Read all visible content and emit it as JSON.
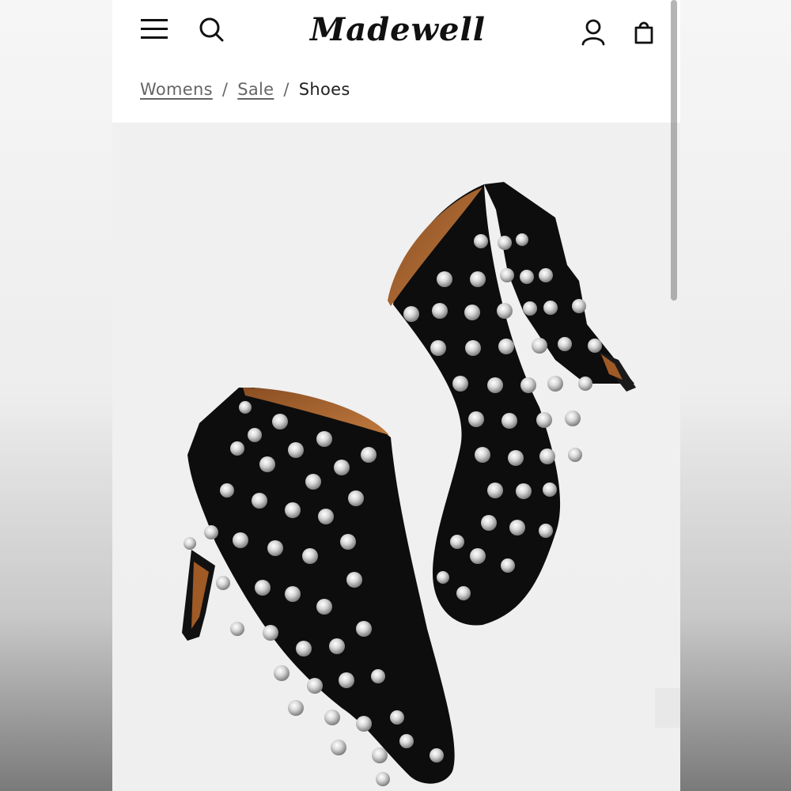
{
  "brand": {
    "logo_text": "Madewell"
  },
  "header": {
    "menu_icon": "hamburger-menu-icon",
    "search_icon": "search-icon",
    "account_icon": "account-icon",
    "bag_icon": "shopping-bag-icon"
  },
  "breadcrumb": {
    "items": [
      "Womens",
      "Sale"
    ],
    "separator": "/",
    "current": "Shoes"
  },
  "product": {
    "image_icon": "studded-ankle-boots-image"
  },
  "colors": {
    "text": "#222222",
    "link": "#666666",
    "background": "#ffffff",
    "image_bg": "#efefef"
  }
}
